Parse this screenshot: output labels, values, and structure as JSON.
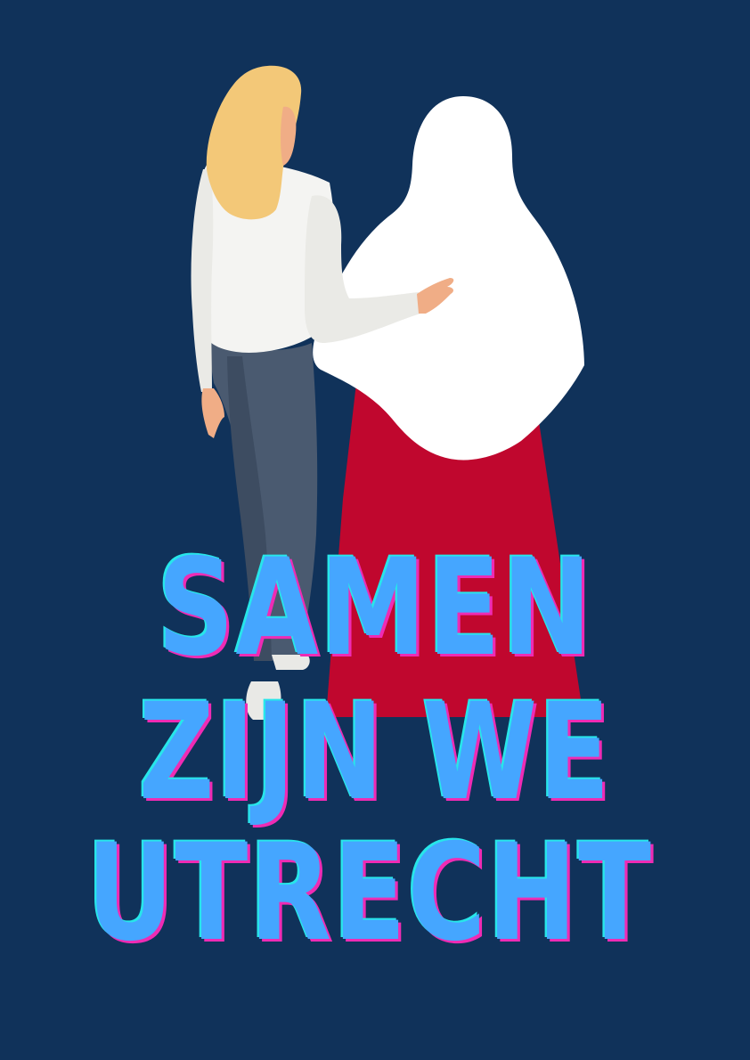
{
  "colors": {
    "background": "#10325a",
    "text_fill": "#45a6ff",
    "text_shadow_cyan": "#27e6ea",
    "text_shadow_magenta": "#ef2bb4",
    "skirt_red": "#c0072e",
    "hair_blonde": "#f3c878",
    "skin": "#f0ad86",
    "jeans": "#4a5a70",
    "shirt_white": "#f4f4f2",
    "hijab_white": "#ffffff"
  },
  "headline": {
    "line1": "SAMEN",
    "line2": "ZIJN WE",
    "line3": "UTRECHT"
  }
}
